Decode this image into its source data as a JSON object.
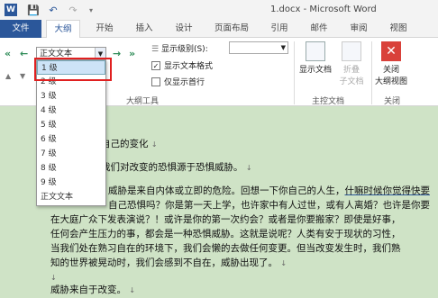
{
  "window": {
    "title": "1.docx - Microsoft Word",
    "app_icon": "W"
  },
  "quick_access": {
    "save_icon": "save-icon",
    "undo_icon": "undo-icon",
    "redo_icon": "redo-icon"
  },
  "tabs": [
    "文件",
    "大纲",
    "开始",
    "插入",
    "设计",
    "页面布局",
    "引用",
    "邮件",
    "审阅",
    "视图"
  ],
  "ribbon": {
    "outline_level_value": "正文文本",
    "show_level_label": "显示级别(S):",
    "show_text_format": "显示文本格式",
    "show_first_line": "仅显示首行",
    "group_outline_tools": "大纲工具",
    "show_document": "显示文档",
    "collapse_subdocs_line1": "折叠",
    "collapse_subdocs_line2": "子文档",
    "group_master_document": "主控文档",
    "close_outline_line1": "关闭",
    "close_outline_line2": "大纲视图",
    "group_close": "关闭"
  },
  "dropdown": {
    "items": [
      "1 级",
      "2 级",
      "3 级",
      "4 级",
      "5 级",
      "6 级",
      "7 级",
      "8 级",
      "9 级",
      "正文文本"
    ],
    "selected": "1 级"
  },
  "document": {
    "lines": [
      "自己的变化",
      "我们对改变的恐惧源于恐惧威胁。",
      "威胁是来自内体或立即的危险。回想一下你自己的人生，",
      "自己恐惧吗？你是第一天上学，也许家中有人过世，或",
      "在大庭广众下发表演说？！或许是你的第一次约会？或者是你要搬家？即使是好事，",
      "任何会产生压力的事，都会是一种恐惧威胁。这就是说呢？人类有安于现状的习性，",
      "当我们处在熟习自在的环境下，我们会懒的去做任何变更。但当改变发生时，我们熟",
      "知的世界被晃动时，我们会感到不自在，威胁出现了。",
      "威胁来自于改变。"
    ],
    "line1_extra": "什嘛时候你觉得快要",
    "line2_extra": "有人离婚？也许是你要"
  }
}
